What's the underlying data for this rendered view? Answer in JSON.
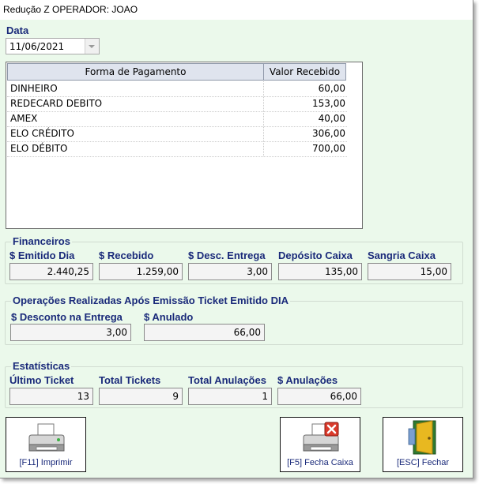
{
  "window": {
    "title": "Redução Z OPERADOR: JOAO"
  },
  "date": {
    "label": "Data",
    "value": "11/06/2021"
  },
  "payments": {
    "columns": [
      "Forma de Pagamento",
      "Valor Recebido"
    ],
    "rows": [
      {
        "method": "DINHEIRO",
        "value": "60,00"
      },
      {
        "method": "REDECARD DEBITO",
        "value": "153,00"
      },
      {
        "method": "AMEX",
        "value": "40,00"
      },
      {
        "method": "ELO CRÉDITO",
        "value": "306,00"
      },
      {
        "method": "ELO DÉBITO",
        "value": "700,00"
      }
    ]
  },
  "financeiros": {
    "title": "Financeiros",
    "emitido_dia": {
      "label": "$ Emitido Dia",
      "value": "2.440,25"
    },
    "recebido": {
      "label": "$ Recebido",
      "value": "1.259,00"
    },
    "desc_entrega": {
      "label": "$ Desc. Entrega",
      "value": "3,00"
    },
    "deposito_caixa": {
      "label": "Depósito Caixa",
      "value": "135,00"
    },
    "sangria_caixa": {
      "label": "Sangria Caixa",
      "value": "15,00"
    }
  },
  "operacoes": {
    "title": "Operações Realizadas Após Emissão Ticket Emitido DIA",
    "desconto_entrega": {
      "label": "$ Desconto na Entrega",
      "value": "3,00"
    },
    "anulado": {
      "label": "$ Anulado",
      "value": "66,00"
    }
  },
  "estatisticas": {
    "title": "Estatísticas",
    "ultimo_ticket": {
      "label": "Último Ticket",
      "value": "13"
    },
    "total_tickets": {
      "label": "Total Tickets",
      "value": "9"
    },
    "total_anulacoes": {
      "label": "Total Anulações",
      "value": "1"
    },
    "anulacoes": {
      "label": "$ Anulações",
      "value": "66,00"
    }
  },
  "buttons": {
    "imprimir": {
      "label": "[F11] Imprimir",
      "icon": "printer-icon"
    },
    "fecha_caixa": {
      "label": "[F5] Fecha Caixa",
      "icon": "printer-close-icon"
    },
    "fechar": {
      "label": "[ESC] Fechar",
      "icon": "exit-door-icon"
    }
  },
  "colors": {
    "background": "#ebf9eb",
    "label": "#1a2a7a",
    "close_red": "#d93a2b",
    "door_green": "#2f7a2f",
    "door_yellow": "#e8b820"
  }
}
